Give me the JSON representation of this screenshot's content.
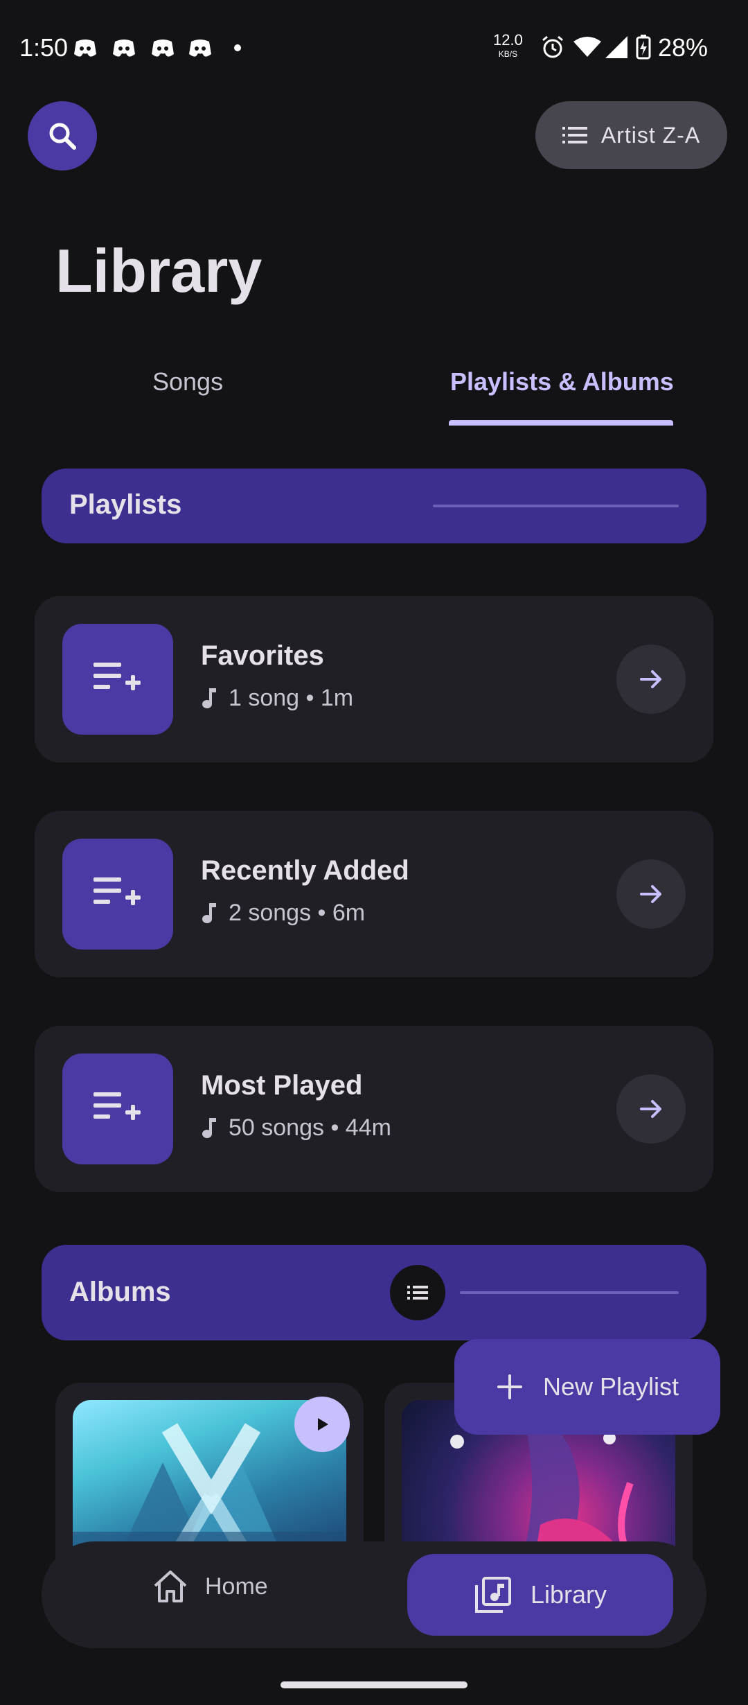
{
  "status_bar": {
    "time": "1:50",
    "net_speed_value": "12.0",
    "net_speed_unit": "KB/S",
    "battery": "28%"
  },
  "header": {
    "sort_label": "Artist Z-A",
    "title": "Library"
  },
  "tabs": [
    {
      "label": "Songs",
      "selected": false
    },
    {
      "label": "Playlists & Albums",
      "selected": true
    }
  ],
  "playlists_section": {
    "label": "Playlists"
  },
  "playlists": [
    {
      "name": "Favorites",
      "meta": "1 song • 1m"
    },
    {
      "name": "Recently Added",
      "meta": "2 songs • 6m"
    },
    {
      "name": "Most Played",
      "meta": "50 songs • 44m"
    }
  ],
  "albums_section": {
    "label": "Albums"
  },
  "fab": {
    "label": "New Playlist"
  },
  "bottom_nav": {
    "home": "Home",
    "library": "Library"
  },
  "colors": {
    "background": "#131316",
    "accent": "#4b3aa3",
    "accent_light": "#c8bfff",
    "card": "#201f25"
  }
}
